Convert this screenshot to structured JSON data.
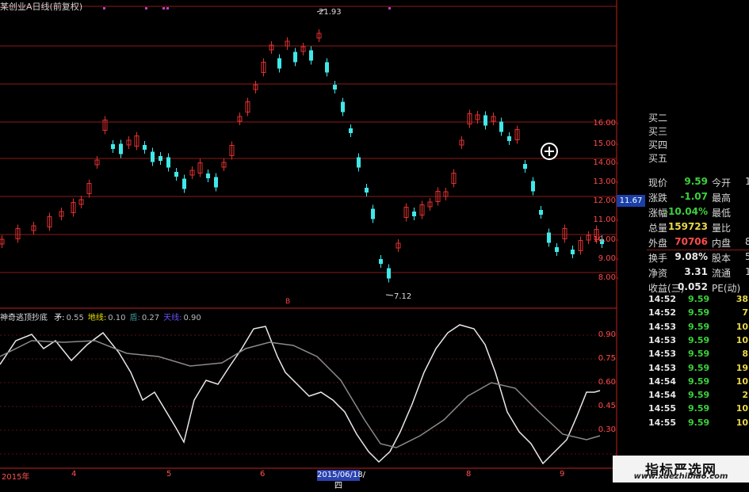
{
  "window": {
    "title": "某创业A日线(前复权)"
  },
  "price_axis": {
    "ticks": [
      "16.00",
      "15.00",
      "14.00",
      "13.00",
      "12.00",
      "11.00",
      "10.00",
      "9.00",
      "8.00"
    ],
    "current_price_badge": "11.67"
  },
  "annotations": {
    "high_label": "21.93",
    "low_label": "7.12"
  },
  "indicator": {
    "name": "神奇逃顶抄底",
    "items": [
      {
        "label": "矛:",
        "value": "0.55",
        "color": "#e8e8e8"
      },
      {
        "label": "地线:",
        "value": "0.10",
        "color": "#e8e000"
      },
      {
        "label": "盾:",
        "value": "0.27",
        "color": "#3c8f8f"
      },
      {
        "label": "天线:",
        "value": "0.90",
        "color": "#6a50ff"
      }
    ],
    "ticks": [
      "0.90",
      "0.75",
      "0.60",
      "0.45",
      "0.30"
    ]
  },
  "order_book_labels": [
    "买二",
    "买三",
    "买四",
    "买五"
  ],
  "quote": [
    {
      "label": "现价",
      "value": "9.59",
      "value_color": "#3cd13c",
      "label2": "今开",
      "value2": "1"
    },
    {
      "label": "涨跌",
      "value": "-1.07",
      "value_color": "#3cd13c",
      "label2": "最高",
      "value2": ""
    },
    {
      "label": "涨幅",
      "value": "-10.04%",
      "value_color": "#3cd13c",
      "label2": "最低",
      "value2": ""
    },
    {
      "label": "总量",
      "value": "159723",
      "value_color": "#e8d84a",
      "label2": "量比",
      "value2": ""
    },
    {
      "label": "外盘",
      "value": "70706",
      "value_color": "#ff4b4b",
      "label2": "内盘",
      "value2": "8"
    },
    {
      "label": "换手",
      "value": "9.08%",
      "value_color": "#e8e8e8",
      "label2": "股本",
      "value2": "5"
    },
    {
      "label": "净资",
      "value": "3.31",
      "value_color": "#e8e8e8",
      "label2": "流通",
      "value2": "1"
    },
    {
      "label": "收益(三)",
      "value": "0.052",
      "value_color": "#e8e8e8",
      "label2": "PE(动)",
      "value2": ""
    }
  ],
  "ticks_list": [
    {
      "time": "14:52",
      "price": "9.59",
      "vol": "38",
      "side": "B"
    },
    {
      "time": "14:52",
      "price": "9.59",
      "vol": "7",
      "side": "B"
    },
    {
      "time": "14:53",
      "price": "9.59",
      "vol": "10",
      "side": "B"
    },
    {
      "time": "14:53",
      "price": "9.59",
      "vol": "10",
      "side": "B"
    },
    {
      "time": "14:53",
      "price": "9.59",
      "vol": "8",
      "side": "B"
    },
    {
      "time": "14:53",
      "price": "9.59",
      "vol": "19",
      "side": "B"
    },
    {
      "time": "14:54",
      "price": "9.59",
      "vol": "10",
      "side": "B"
    },
    {
      "time": "14:54",
      "price": "9.59",
      "vol": "2",
      "side": "B"
    },
    {
      "time": "14:55",
      "price": "9.59",
      "vol": "10",
      "side": "B"
    },
    {
      "time": "14:55",
      "price": "9.59",
      "vol": "10",
      "side": "B"
    }
  ],
  "time_axis": {
    "labels": [
      "2015年",
      "4",
      "5",
      "6",
      "8",
      "9"
    ],
    "date_badge": "2015/06/18/四"
  },
  "watermark": {
    "title": "指标严选网",
    "url": "www.xuezhibiao.com"
  },
  "colors": {
    "up": "#e03030",
    "down": "#40e8e8",
    "grid": "#8b1a1a",
    "axis": "#c02020"
  }
}
